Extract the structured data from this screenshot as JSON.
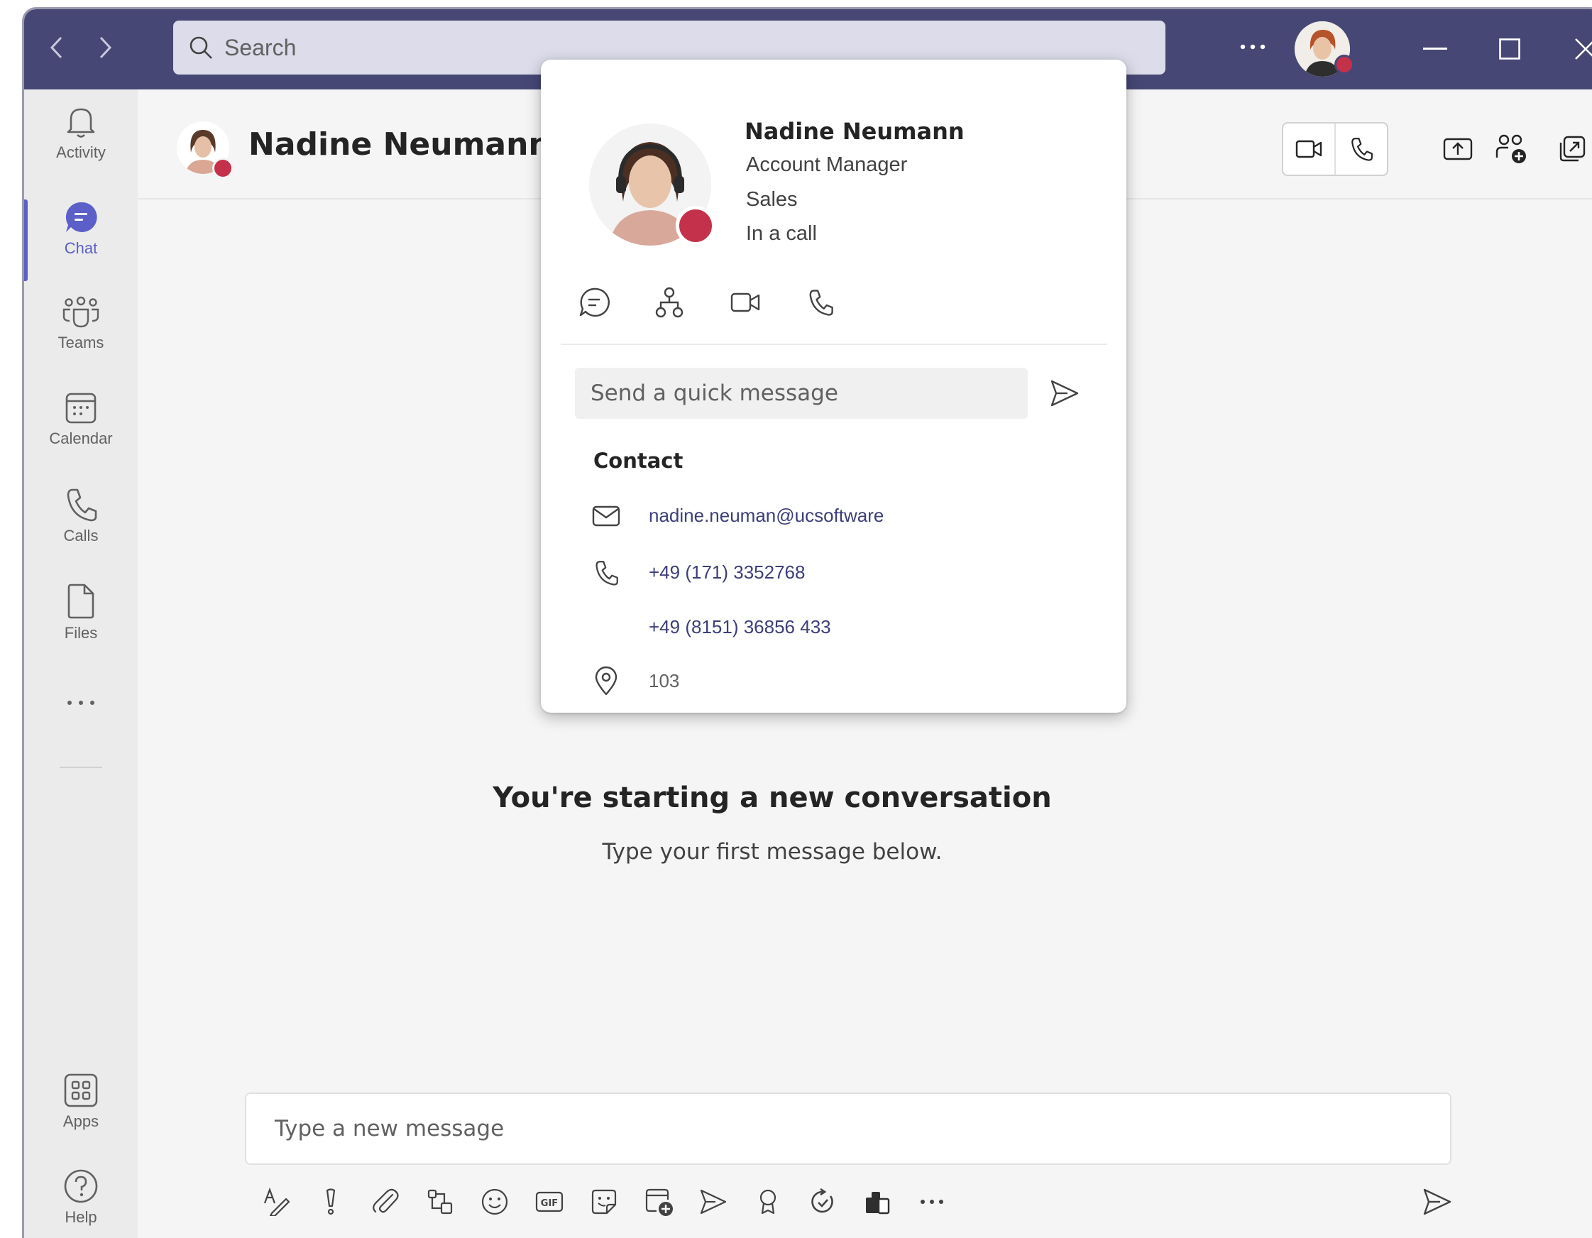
{
  "titlebar": {
    "search_placeholder": "Search",
    "more_label": "···"
  },
  "rail": {
    "items": [
      {
        "label": "Activity"
      },
      {
        "label": "Chat"
      },
      {
        "label": "Teams"
      },
      {
        "label": "Calendar"
      },
      {
        "label": "Calls"
      },
      {
        "label": "Files"
      },
      {
        "label": "Apps"
      },
      {
        "label": "Help"
      }
    ],
    "more_label": "···"
  },
  "header": {
    "name": "Nadine Neumann"
  },
  "profile_card": {
    "name": "Nadine Neumann",
    "title": "Account Manager",
    "department": "Sales",
    "status": "In a call",
    "quick_message_placeholder": "Send a quick message",
    "contact_heading": "Contact",
    "email": "nadine.neuman@ucsoftware",
    "phone_mobile": "+49 (171) 3352768",
    "phone_work": "+49 (8151) 36856 433",
    "location": "103"
  },
  "conversation": {
    "title": "You're starting a new conversation",
    "subtitle": "Type your first message below."
  },
  "compose": {
    "placeholder": "Type a new message",
    "more_label": "···"
  },
  "colors": {
    "titlebar": "#464775",
    "accent": "#5b5fc7",
    "busy": "#c4314b",
    "link": "#3d3e78"
  }
}
